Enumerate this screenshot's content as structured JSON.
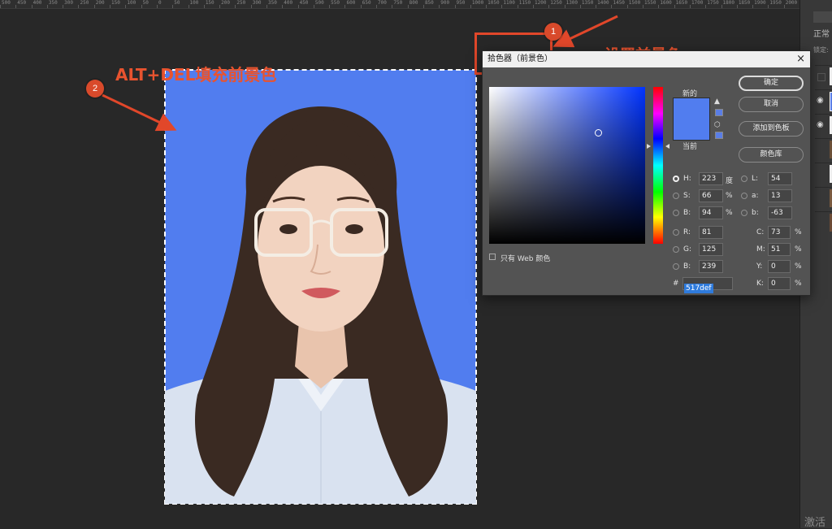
{
  "ruler": {
    "marks": [
      "500",
      "450",
      "400",
      "350",
      "300",
      "250",
      "200",
      "150",
      "100",
      "50",
      "0",
      "50",
      "100",
      "150",
      "200",
      "250",
      "300",
      "350",
      "400",
      "450",
      "500",
      "550",
      "600",
      "650",
      "700",
      "750",
      "800",
      "850",
      "900",
      "950",
      "1000",
      "1050",
      "1100",
      "1150",
      "1200",
      "1250",
      "1300",
      "1350",
      "1400",
      "1450",
      "1500",
      "1550",
      "1600",
      "1650",
      "1700",
      "1750",
      "1800",
      "1850",
      "1900",
      "1950",
      "2000"
    ]
  },
  "right_panel": {
    "mode": "正常",
    "lock": "锁定:",
    "activate": "激活"
  },
  "annotations": {
    "step1_number": "1",
    "step1_text": "设置前景色",
    "step2_number": "2",
    "step2_text": "ALT+DEL填充前景色"
  },
  "picker": {
    "title": "拾色器（前景色）",
    "close": "×",
    "new_label": "新的",
    "current_label": "当前",
    "buttons": {
      "ok": "确定",
      "cancel": "取消",
      "add_swatch": "添加到色板",
      "library": "颜色库"
    },
    "web_only": "只有 Web 颜色",
    "hsb": [
      {
        "key": "H:",
        "value": "223",
        "unit": "度"
      },
      {
        "key": "S:",
        "value": "66",
        "unit": "%"
      },
      {
        "key": "B:",
        "value": "94",
        "unit": "%"
      }
    ],
    "rgb": [
      {
        "key": "R:",
        "value": "81"
      },
      {
        "key": "G:",
        "value": "125"
      },
      {
        "key": "B:",
        "value": "239"
      }
    ],
    "lab": [
      {
        "key": "L:",
        "value": "54"
      },
      {
        "key": "a:",
        "value": "13"
      },
      {
        "key": "b:",
        "value": "-63"
      }
    ],
    "cmyk": [
      {
        "key": "C:",
        "value": "73",
        "unit": "%"
      },
      {
        "key": "M:",
        "value": "51",
        "unit": "%"
      },
      {
        "key": "Y:",
        "value": "0",
        "unit": "%"
      },
      {
        "key": "K:",
        "value": "0",
        "unit": "%"
      }
    ],
    "hash": "#",
    "hex": "517def"
  },
  "colors": {
    "new_color": "#517def",
    "accent": "#e8532f",
    "canvas_bg": "#282828"
  }
}
